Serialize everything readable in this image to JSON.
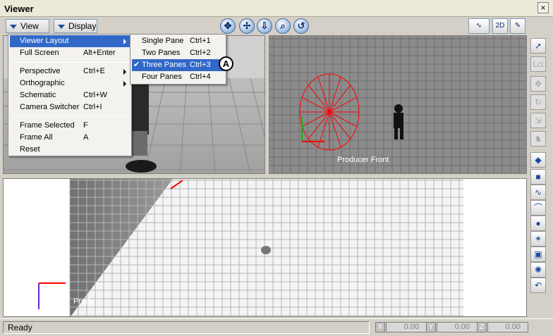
{
  "window": {
    "title": "Viewer",
    "close_glyph": "×"
  },
  "toolbar": {
    "view_label": "View",
    "display_label": "Display",
    "nav_icons": [
      "pan-icon",
      "dolly-icon",
      "orbit-icon",
      "zoom-icon",
      "rotate-icon"
    ],
    "right_tools": [
      {
        "name": "curve-tool-icon",
        "glyph": "∿"
      },
      {
        "name": "frame-2d-icon",
        "glyph": "2D"
      },
      {
        "name": "camera-tool-icon",
        "glyph": "✎"
      }
    ]
  },
  "view_menu": {
    "items": [
      {
        "label": "Viewer Layout",
        "shortcut": "",
        "submenu": true,
        "highlighted": true
      },
      {
        "label": "Full Screen",
        "shortcut": "Alt+Enter",
        "submenu": false
      },
      {
        "label": "Perspective",
        "shortcut": "Ctrl+E",
        "submenu": true
      },
      {
        "label": "Orthographic",
        "shortcut": "",
        "submenu": true
      },
      {
        "label": "Schematic",
        "shortcut": "Ctrl+W",
        "submenu": false
      },
      {
        "label": "Camera Switcher",
        "shortcut": "Ctrl+I",
        "submenu": false
      },
      {
        "label": "Frame Selected",
        "shortcut": "F",
        "submenu": false
      },
      {
        "label": "Frame All",
        "shortcut": "A",
        "submenu": false
      },
      {
        "label": "Reset",
        "shortcut": "",
        "submenu": false
      }
    ]
  },
  "layout_submenu": {
    "items": [
      {
        "label": "Single Pane",
        "shortcut": "Ctrl+1",
        "checked": false
      },
      {
        "label": "Two Panes",
        "shortcut": "Ctrl+2",
        "checked": false
      },
      {
        "label": "Three Panes",
        "shortcut": "Ctrl+3",
        "checked": true
      },
      {
        "label": "Four Panes",
        "shortcut": "Ctrl+4",
        "checked": false
      }
    ],
    "check_glyph": "✔"
  },
  "callout": {
    "label": "A"
  },
  "panes": {
    "top_right_label": "Producer Front",
    "bottom_label": "Produ"
  },
  "sidebar": {
    "tools": [
      {
        "name": "select-arrow-icon",
        "glyph": "➚",
        "enabled": true
      },
      {
        "name": "local-icon",
        "glyph": "Lcl",
        "enabled": false
      },
      {
        "name": "translate-icon",
        "glyph": "✥",
        "enabled": false
      },
      {
        "name": "rotate-tool-icon",
        "glyph": "↻",
        "enabled": false
      },
      {
        "name": "scale-icon",
        "glyph": "⇲",
        "enabled": false
      },
      {
        "name": "pose-icon",
        "glyph": "♞",
        "enabled": false
      },
      {
        "name": "select-object-icon",
        "glyph": "◆",
        "enabled": true
      },
      {
        "name": "cube-icon",
        "glyph": "■",
        "enabled": true
      },
      {
        "name": "curve-icon",
        "glyph": "∿",
        "enabled": true
      },
      {
        "name": "path-icon",
        "glyph": "⌒",
        "enabled": true
      },
      {
        "name": "marker-icon",
        "glyph": "●",
        "enabled": true
      },
      {
        "name": "null-icon",
        "glyph": "✶",
        "enabled": true
      },
      {
        "name": "camera-icon",
        "glyph": "▣",
        "enabled": true
      },
      {
        "name": "light-icon",
        "glyph": "✺",
        "enabled": true
      },
      {
        "name": "constraint-icon",
        "glyph": "↶",
        "enabled": true
      }
    ]
  },
  "statusbar": {
    "status": "Ready",
    "x_label": "X",
    "x_value": "0.00",
    "y_label": "Y",
    "y_value": "0.00",
    "z_label": "Z",
    "z_value": "0.00"
  },
  "colors": {
    "menu_highlight": "#3168c8",
    "selection_red": "#ff0000"
  }
}
